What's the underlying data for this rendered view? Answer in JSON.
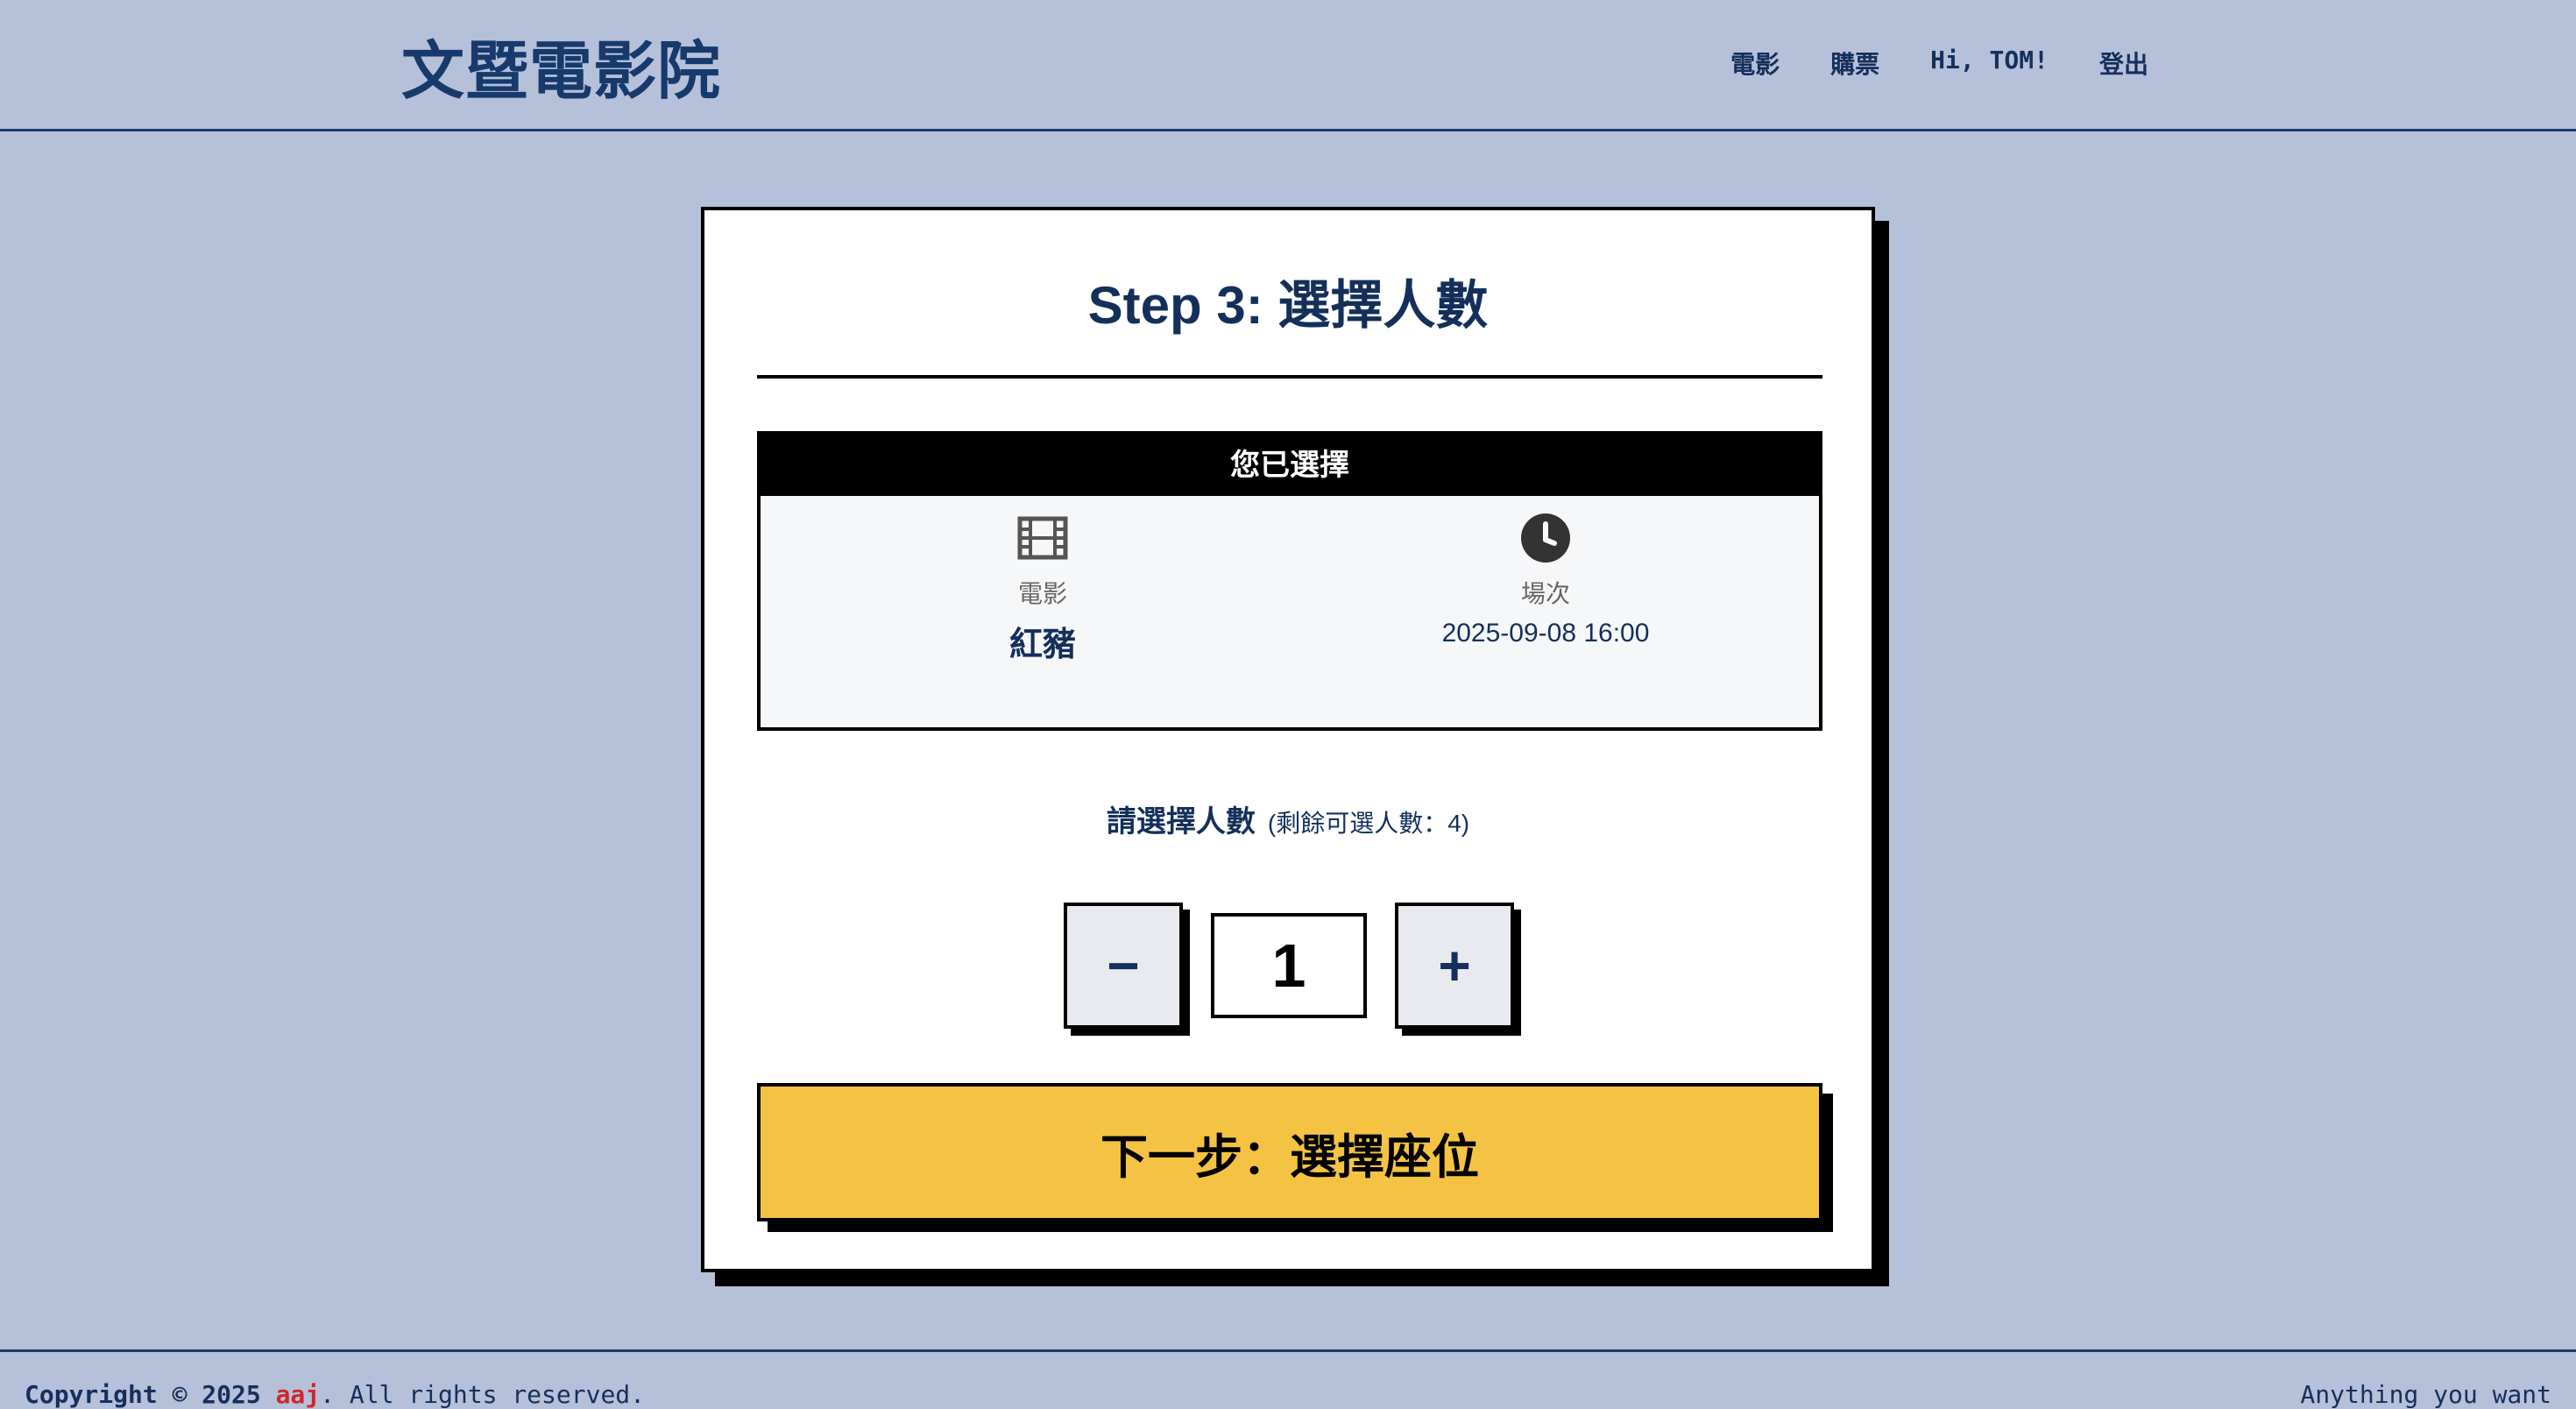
{
  "header": {
    "logo": "文暨電影院",
    "nav": [
      "電影",
      "購票",
      "Hi, TOM!",
      "登出"
    ]
  },
  "main": {
    "step_title": "Step 3: 選擇人數",
    "summary": {
      "heading": "您已選擇",
      "movie_label": "電影",
      "movie_value": "紅豬",
      "movie_icon": "film-icon",
      "time_label": "場次",
      "time_value": "2025-09-08 16:00",
      "time_icon": "clock-icon"
    },
    "count_label": "請選擇人數",
    "count_remaining": "(剩餘可選人數：4)",
    "minus_label": "−",
    "plus_label": "+",
    "quantity": "1",
    "next_button": "下一步：選擇座位"
  },
  "footer": {
    "copyright_prefix": "Copyright © 2025",
    "brand": "aaj",
    "copyright_suffix": ". All rights reserved.",
    "tagline": "Anything you want"
  },
  "colors": {
    "background": "#b5c0d9",
    "primary_text": "#14305a",
    "accent_button": "#f5c344",
    "brand_red": "#d0262b"
  }
}
